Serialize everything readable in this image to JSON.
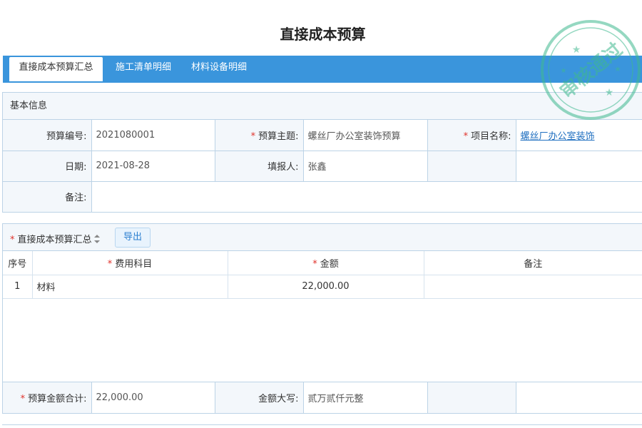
{
  "page": {
    "title": "直接成本预算"
  },
  "tabs": [
    {
      "label": "直接成本预算汇总",
      "active": true
    },
    {
      "label": "施工清单明细",
      "active": false
    },
    {
      "label": "材料设备明细",
      "active": false
    }
  ],
  "basic_info": {
    "section_title": "基本信息",
    "budget_no_label": "预算编号:",
    "budget_no_value": "2021080001",
    "subject_label": "预算主题:",
    "subject_value": "螺丝厂办公室装饰预算",
    "project_label": "项目名称:",
    "project_value": "螺丝厂办公室装饰",
    "date_label": "日期:",
    "date_value": "2021-08-28",
    "reporter_label": "填报人:",
    "reporter_value": "张鑫",
    "remark_label": "备注:",
    "remark_value": ""
  },
  "summary": {
    "title": "直接成本预算汇总",
    "export_label": "导出",
    "columns": {
      "index": "序号",
      "subject": "费用科目",
      "amount": "金额",
      "remark": "备注"
    },
    "rows": [
      {
        "index": "1",
        "subject": "材料",
        "amount": "22,000.00",
        "remark": ""
      }
    ],
    "total_label": "预算金额合计:",
    "total_value": "22,000.00",
    "uppercase_label": "金额大写:",
    "uppercase_value": "贰万贰仟元整"
  },
  "stamp": {
    "text": "审核通过",
    "color": "#3fb98f"
  },
  "colors": {
    "tab_bar": "#3a95dc",
    "required": "#e0322b",
    "link": "#1f6fc0",
    "border": "#bcd3e6"
  }
}
